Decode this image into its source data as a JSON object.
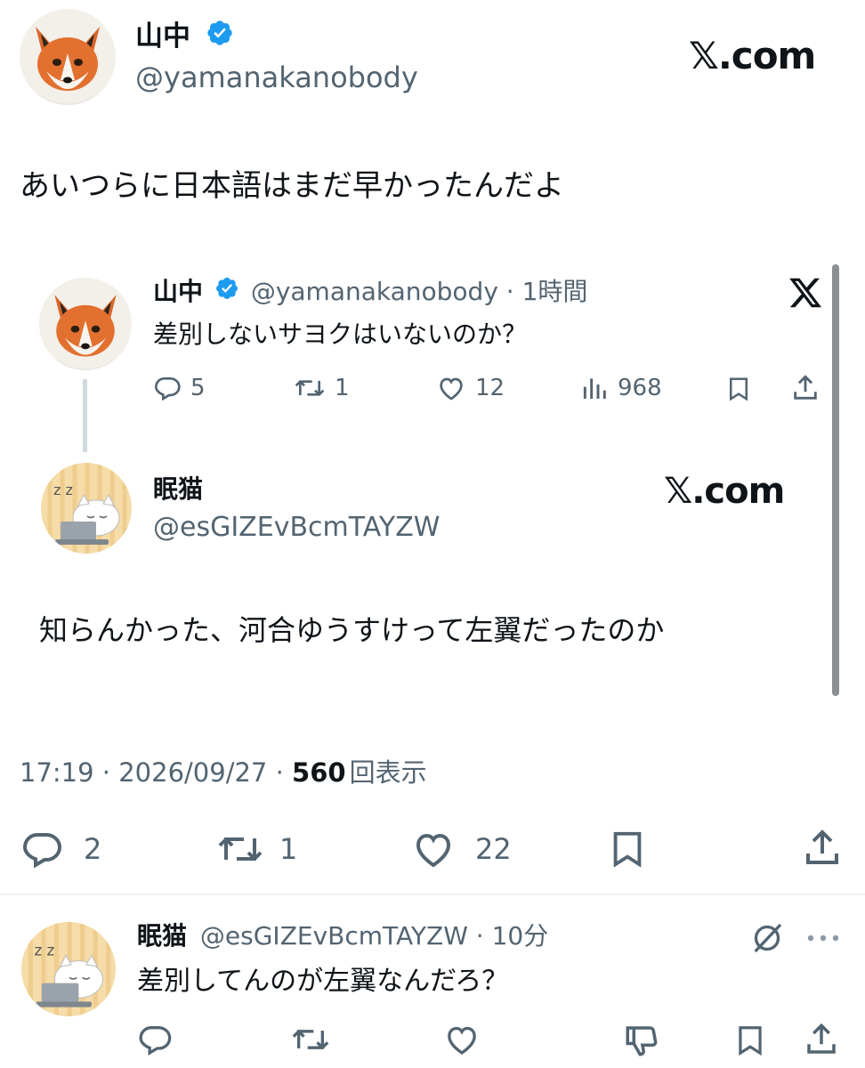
{
  "main_tweet": {
    "display_name": "山中",
    "handle": "@yamanakanobody",
    "brand": "𝕏.com",
    "text": "あいつらに日本語はまだ早かったんだよ",
    "timestamp": "17:19 · 2026/09/27 · ",
    "views_count": "560",
    "views_label": "回表示",
    "reply_count": "2",
    "retweet_count": "1",
    "like_count": "22"
  },
  "quoted_tweet_1": {
    "display_name": "山中",
    "handle_time": "@yamanakanobody · 1時間",
    "text": "差別しないサヨクはいないのか？",
    "reply_count": "5",
    "retweet_count": "1",
    "like_count": "12",
    "views_count": "968"
  },
  "quoted_tweet_2": {
    "display_name": "眠猫",
    "handle": "@esGIZEvBcmTAYZW",
    "brand": "𝕏.com",
    "text": "知らんかった、河合ゆうすけって左翼だったのか"
  },
  "reply_tweet": {
    "display_name": "眠猫",
    "handle_time": "@esGIZEvBcmTAYZW · 10分",
    "text": "差別してんのが左翼なんだろ？"
  },
  "colors": {
    "verified_blue": "#1d9bf0",
    "text_primary": "#0f1419",
    "text_secondary": "#536471"
  },
  "icons": [
    "verified-badge-icon",
    "x-logo-icon",
    "reply-icon",
    "retweet-icon",
    "like-icon",
    "views-icon",
    "bookmark-icon",
    "share-icon",
    "grok-icon",
    "more-icon",
    "dislike-icon"
  ]
}
